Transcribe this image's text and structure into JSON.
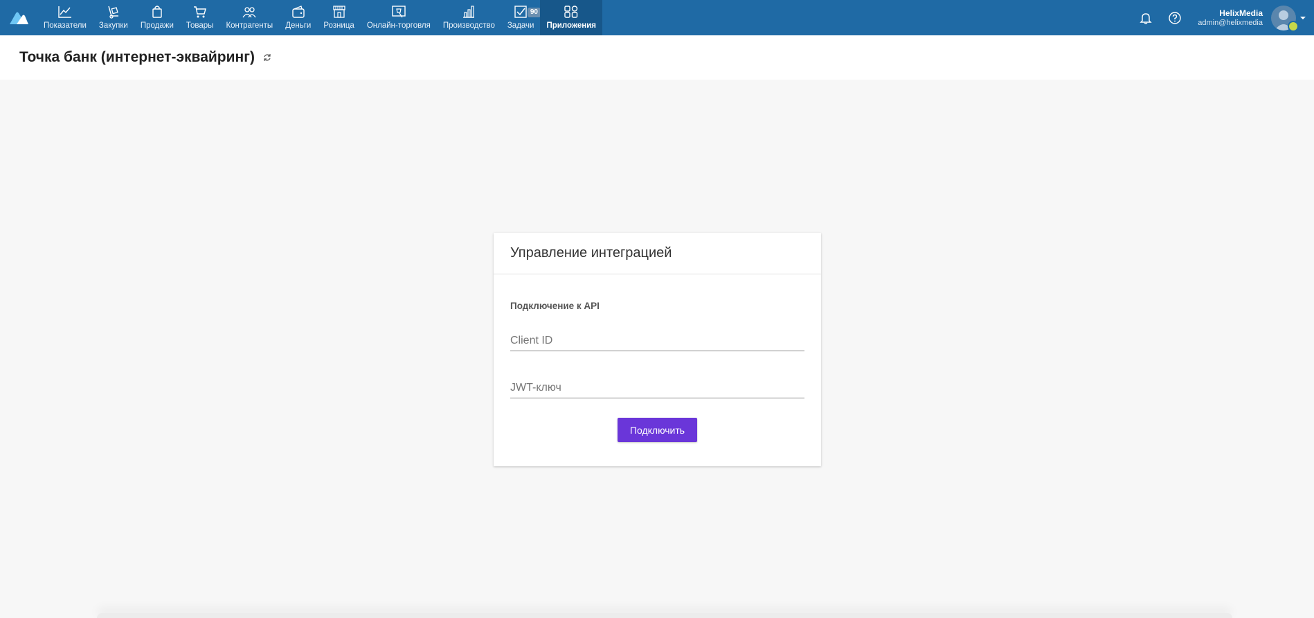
{
  "nav": {
    "items": [
      {
        "label": "Показатели",
        "icon": "chart-line-icon"
      },
      {
        "label": "Закупки",
        "icon": "dolly-icon"
      },
      {
        "label": "Продажи",
        "icon": "shopping-bag-icon"
      },
      {
        "label": "Товары",
        "icon": "cart-icon"
      },
      {
        "label": "Контрагенты",
        "icon": "people-icon"
      },
      {
        "label": "Деньги",
        "icon": "wallet-icon"
      },
      {
        "label": "Розница",
        "icon": "store-icon"
      },
      {
        "label": "Онлайн-торговля",
        "icon": "online-store-icon"
      },
      {
        "label": "Производство",
        "icon": "bar-chart-icon"
      },
      {
        "label": "Задачи",
        "icon": "checkbox-icon",
        "badge": "90"
      },
      {
        "label": "Приложения",
        "icon": "apps-icon",
        "active": true
      }
    ]
  },
  "user": {
    "name": "HelixMedia",
    "email": "admin@helixmedia"
  },
  "page": {
    "title": "Точка банк (интернет-эквайринг)"
  },
  "card": {
    "title": "Управление интеграцией",
    "section_label": "Подключение к API",
    "client_id_placeholder": "Client ID",
    "jwt_placeholder": "JWT-ключ",
    "connect_button": "Подключить"
  },
  "colors": {
    "topbar": "#1f6aa5",
    "topbar_active": "#17578a",
    "button": "#6a36d9",
    "background": "#f7f7f7"
  }
}
